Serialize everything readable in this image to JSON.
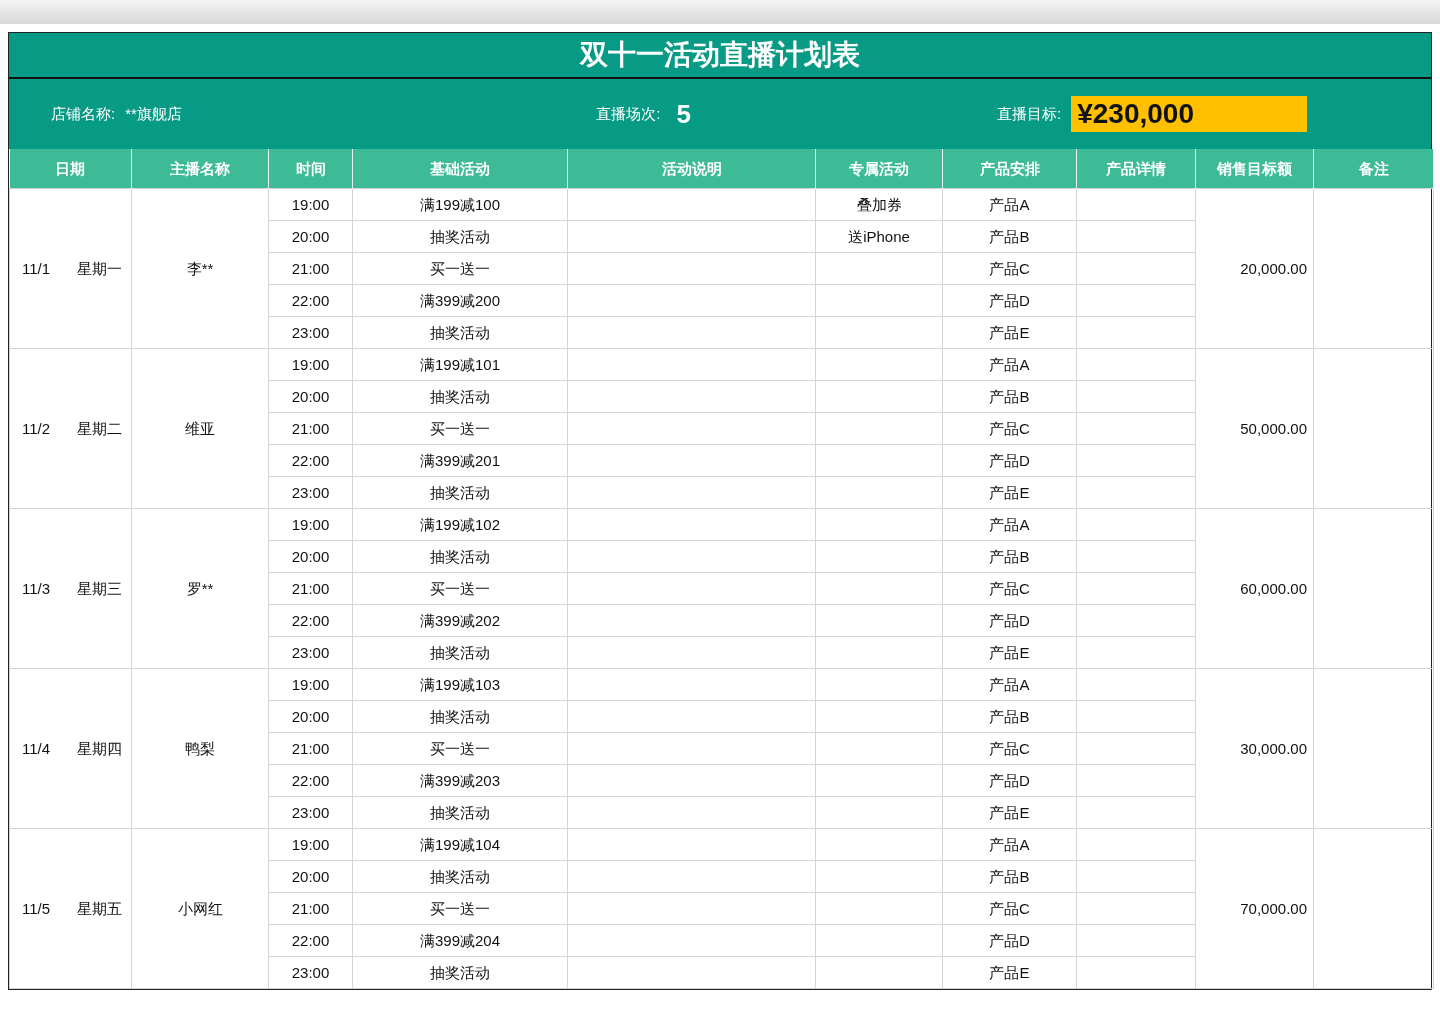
{
  "title": "双十一活动直播计划表",
  "shop": {
    "label": "店铺名称:",
    "value": "**旗舰店"
  },
  "sessions": {
    "label": "直播场次:",
    "value": "5"
  },
  "target": {
    "label": "直播目标:",
    "value": "¥230,000"
  },
  "columns": [
    "日期",
    "主播名称",
    "时间",
    "基础活动",
    "活动说明",
    "专属活动",
    "产品安排",
    "产品详情",
    "销售目标额",
    "备注"
  ],
  "days": [
    {
      "date": "11/1",
      "weekday": "星期一",
      "host": "李**",
      "sales_target": "20,000.00",
      "slots": [
        {
          "time": "19:00",
          "activity": "满199减100",
          "exclusive": "叠加券",
          "product": "产品A"
        },
        {
          "time": "20:00",
          "activity": "抽奖活动",
          "exclusive": "送iPhone",
          "product": "产品B"
        },
        {
          "time": "21:00",
          "activity": "买一送一",
          "product": "产品C"
        },
        {
          "time": "22:00",
          "activity": "满399减200",
          "product": "产品D"
        },
        {
          "time": "23:00",
          "activity": "抽奖活动",
          "product": "产品E"
        }
      ]
    },
    {
      "date": "11/2",
      "weekday": "星期二",
      "host": "维亚",
      "sales_target": "50,000.00",
      "slots": [
        {
          "time": "19:00",
          "activity": "满199减101",
          "product": "产品A"
        },
        {
          "time": "20:00",
          "activity": "抽奖活动",
          "product": "产品B"
        },
        {
          "time": "21:00",
          "activity": "买一送一",
          "product": "产品C"
        },
        {
          "time": "22:00",
          "activity": "满399减201",
          "product": "产品D"
        },
        {
          "time": "23:00",
          "activity": "抽奖活动",
          "product": "产品E"
        }
      ]
    },
    {
      "date": "11/3",
      "weekday": "星期三",
      "host": "罗**",
      "sales_target": "60,000.00",
      "slots": [
        {
          "time": "19:00",
          "activity": "满199减102",
          "product": "产品A"
        },
        {
          "time": "20:00",
          "activity": "抽奖活动",
          "product": "产品B"
        },
        {
          "time": "21:00",
          "activity": "买一送一",
          "product": "产品C"
        },
        {
          "time": "22:00",
          "activity": "满399减202",
          "product": "产品D"
        },
        {
          "time": "23:00",
          "activity": "抽奖活动",
          "product": "产品E"
        }
      ]
    },
    {
      "date": "11/4",
      "weekday": "星期四",
      "host": "鸭梨",
      "sales_target": "30,000.00",
      "slots": [
        {
          "time": "19:00",
          "activity": "满199减103",
          "product": "产品A"
        },
        {
          "time": "20:00",
          "activity": "抽奖活动",
          "product": "产品B"
        },
        {
          "time": "21:00",
          "activity": "买一送一",
          "product": "产品C"
        },
        {
          "time": "22:00",
          "activity": "满399减203",
          "product": "产品D"
        },
        {
          "time": "23:00",
          "activity": "抽奖活动",
          "product": "产品E"
        }
      ]
    },
    {
      "date": "11/5",
      "weekday": "星期五",
      "host": "小网红",
      "sales_target": "70,000.00",
      "slots": [
        {
          "time": "19:00",
          "activity": "满199减104",
          "product": "产品A"
        },
        {
          "time": "20:00",
          "activity": "抽奖活动",
          "product": "产品B"
        },
        {
          "time": "21:00",
          "activity": "买一送一",
          "product": "产品C"
        },
        {
          "time": "22:00",
          "activity": "满399减204",
          "product": "产品D"
        },
        {
          "time": "23:00",
          "activity": "抽奖活动",
          "product": "产品E"
        }
      ]
    }
  ]
}
